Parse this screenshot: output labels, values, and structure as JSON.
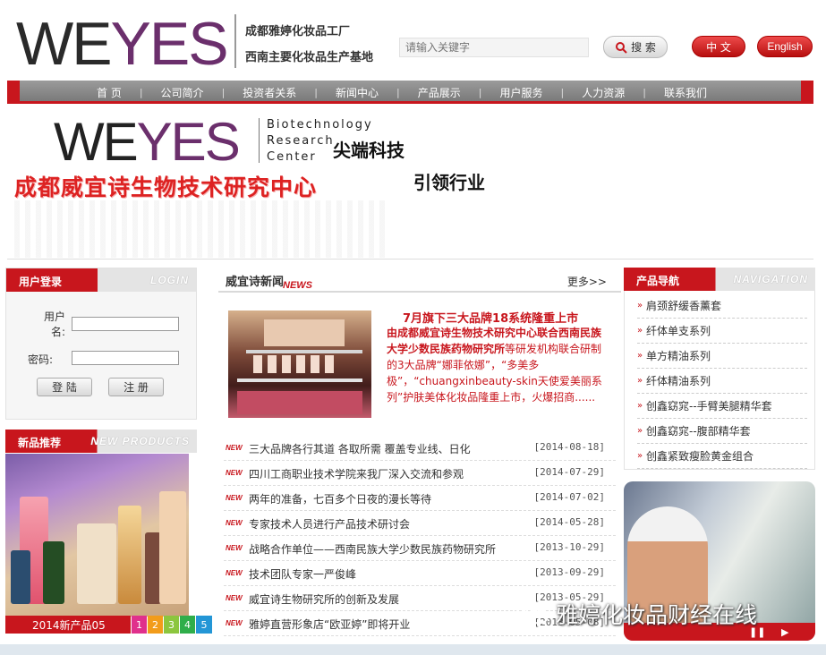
{
  "header": {
    "logo_we": "WE",
    "logo_yes": "YES",
    "tagline_1": "成都雅婷化妆品工厂",
    "tagline_2": "西南主要化妆品生产基地",
    "search_placeholder": "请输入关键字",
    "search_label": "搜 索",
    "lang_cn": "中 文",
    "lang_en": "English"
  },
  "nav": {
    "items": [
      "首 页",
      "公司简介",
      "投资者关系",
      "新闻中心",
      "产品展示",
      "用户服务",
      "人力资源",
      "联系我们"
    ]
  },
  "banner": {
    "logo_we": "WE",
    "logo_yes": "YES",
    "bio_lines": [
      "Biotechnology",
      "Research",
      "Center"
    ],
    "slogan_1": "尖端科技",
    "slogan_2": "引领行业",
    "center_name": "成都威宜诗生物技术研究中心"
  },
  "login": {
    "title": "用户登录",
    "title_en": "LOGIN",
    "username_label": "用户名:",
    "password_label": "密码:",
    "login_button": "登 陆",
    "register_button": "注 册"
  },
  "new_products": {
    "title": "新品推荐",
    "title_en": "NEW PRODUCTS",
    "caption": "2014新产品05",
    "pages": [
      "1",
      "2",
      "3",
      "4",
      "5"
    ]
  },
  "news": {
    "title": "威宜诗新闻",
    "title_en": "NEWS",
    "more": "更多>>",
    "featured_title": "7月旗下三大品牌18系统隆重上市",
    "featured_lead": "由成都威宜诗生物技术研究中心联合西南民族大学少数民族药物研究所",
    "featured_body": "等研发机构联合研制的3大品牌“娜菲依娜”，“多美多极”，“chuangxinbeauty-skin天使爱美丽系列”护肤美体化妆品隆重上市，火爆招商......",
    "badge": "NEW",
    "items": [
      {
        "title": "三大品牌各行其道 各取所需 覆盖专业线、日化",
        "date": "[2014-08-18]"
      },
      {
        "title": "四川工商职业技术学院来我厂深入交流和参观",
        "date": "[2014-07-29]"
      },
      {
        "title": "两年的准备，七百多个日夜的漫长等待",
        "date": "[2014-07-02]"
      },
      {
        "title": "专家技术人员进行产品技术研讨会",
        "date": "[2014-05-28]"
      },
      {
        "title": "战略合作单位——西南民族大学少数民族药物研究所",
        "date": "[2013-10-29]"
      },
      {
        "title": "技术团队专家一严俊峰",
        "date": "[2013-09-29]"
      },
      {
        "title": "威宜诗生物研究所的创新及发展",
        "date": "[2013-05-29]"
      },
      {
        "title": "雅婷直营形象店“欧亚婷”即将开业",
        "date": "[2013-05-08]"
      }
    ]
  },
  "product_nav": {
    "title": "产品导航",
    "title_en": "NAVIGATION",
    "items": [
      "肩颈舒缓香薰套",
      "纤体单支系列",
      "单方精油系列",
      "纤体精油系列",
      "创鑫窈窕--手臂美腿精华套",
      "创鑫窈窕--腹部精华套",
      "创鑫紧致瘦脸黄金组合"
    ]
  },
  "watermark": {
    "text": "雅婷化妆品财经在线"
  },
  "colors": {
    "brand_red": "#c8161d",
    "logo_purple": "#6b2f6c",
    "nav_gray": "#8a8a8a"
  }
}
